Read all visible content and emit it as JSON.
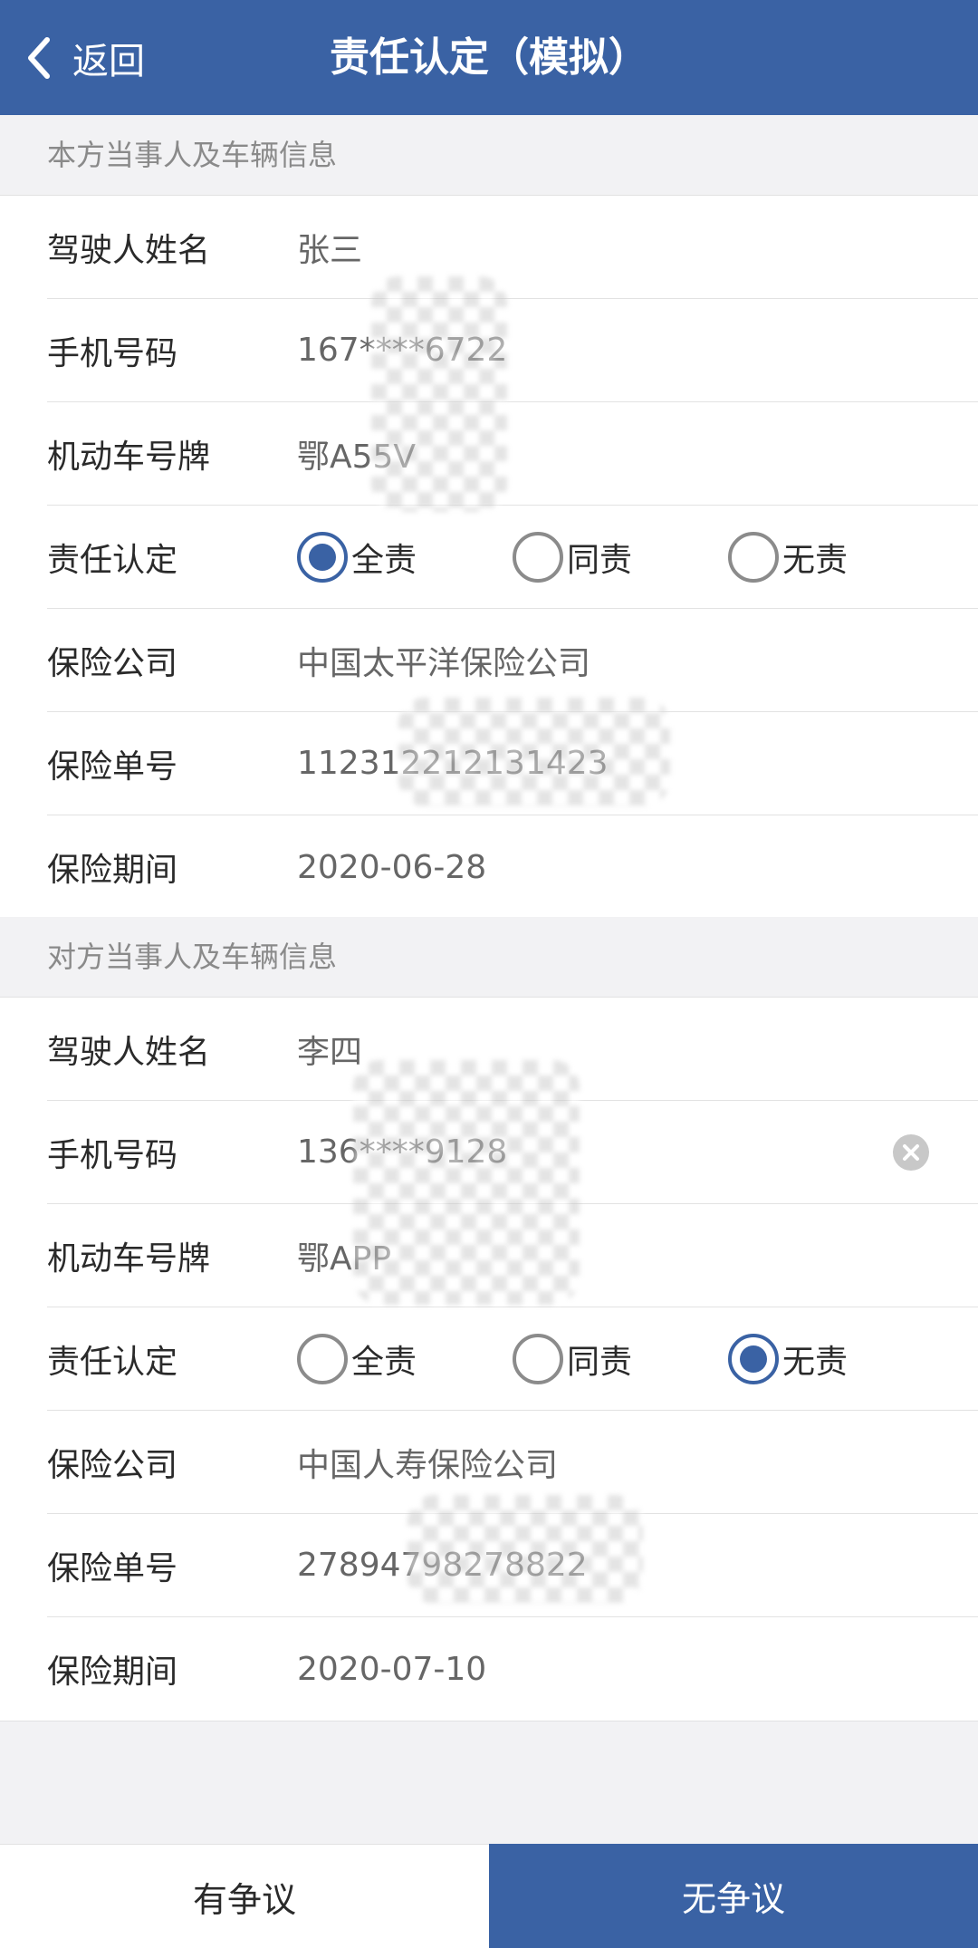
{
  "navbar": {
    "back_label": "返回",
    "title": "责任认定（模拟）"
  },
  "own_party": {
    "header": "本方当事人及车辆信息",
    "rows": [
      {
        "label": "驾驶人姓名",
        "value": "张三"
      },
      {
        "label": "手机号码",
        "value": "167****6722"
      },
      {
        "label": "机动车号牌",
        "value": "鄂A55V"
      },
      {
        "label": "责任认定"
      },
      {
        "label": "保险公司",
        "value": "中国太平洋保险公司"
      },
      {
        "label": "保险单号",
        "value": "112312212131423"
      },
      {
        "label": "保险期间",
        "value": "2020-06-28"
      }
    ],
    "liability": {
      "options": [
        "全责",
        "同责",
        "无责"
      ],
      "selected": "全责"
    }
  },
  "other_party": {
    "header": "对方当事人及车辆信息",
    "rows": [
      {
        "label": "驾驶人姓名",
        "value": "李四"
      },
      {
        "label": "手机号码",
        "value": "136****9128"
      },
      {
        "label": "机动车号牌",
        "value": "鄂APP"
      },
      {
        "label": "责任认定"
      },
      {
        "label": "保险公司",
        "value": "中国人寿保险公司"
      },
      {
        "label": "保险单号",
        "value": "27894798278822"
      },
      {
        "label": "保险期间",
        "value": "2020-07-10"
      }
    ],
    "liability": {
      "options": [
        "全责",
        "同责",
        "无责"
      ],
      "selected": "无责"
    }
  },
  "bottom": {
    "dispute_label": "有争议",
    "no_dispute_label": "无争议"
  },
  "colors": {
    "primary": "#3a62a4",
    "background": "#f2f2f4"
  },
  "icons": {
    "back": "chevron-left-icon",
    "clear": "clear-circle-icon"
  }
}
